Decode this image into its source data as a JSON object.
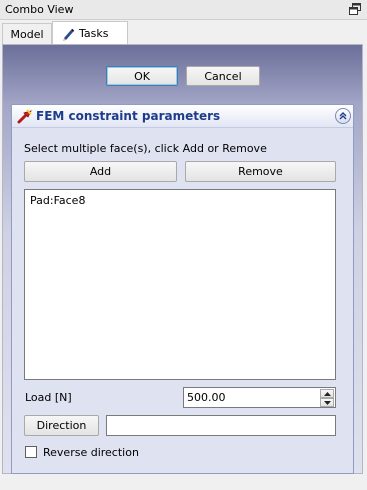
{
  "window": {
    "title": "Combo View",
    "float_icon": "float-window-icon"
  },
  "tabs": [
    {
      "label": "Model",
      "active": false
    },
    {
      "label": "Tasks",
      "active": true,
      "icon": "pencil-icon"
    }
  ],
  "dialog_buttons": {
    "ok_label": "OK",
    "cancel_label": "Cancel"
  },
  "panel": {
    "title": "FEM constraint parameters",
    "icon": "fem-constraint-icon",
    "collapse_icon": "collapse-up-icon",
    "instruction": "Select multiple face(s), click Add or Remove",
    "add_label": "Add",
    "remove_label": "Remove",
    "faces": [
      "Pad:Face8"
    ],
    "load_label": "Load [N]",
    "load_value": "500.00",
    "direction_label": "Direction",
    "direction_value": "",
    "reverse_label": "Reverse direction",
    "reverse_checked": false
  },
  "colors": {
    "panel_title": "#1e3c8c",
    "ok_focus_border": "#3c7fb1"
  }
}
